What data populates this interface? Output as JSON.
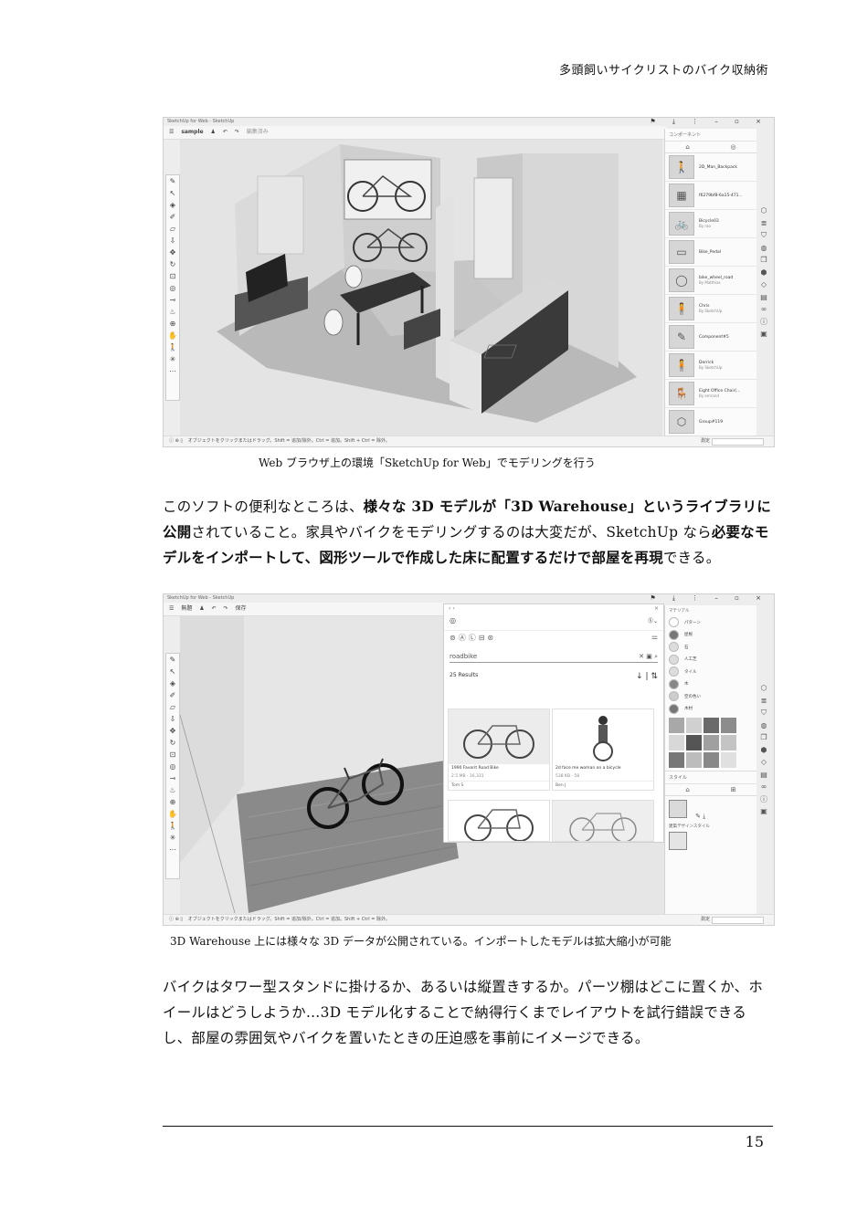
{
  "running_head": "多頭飼いサイクリストのバイク収納術",
  "figure1": {
    "window_title": "SketchUp for Web - SketchUp",
    "file_name": "sample",
    "menu_hint": "編集済み",
    "panel_title": "コンポーネント",
    "components": [
      {
        "name": "2D_Man_Backpack",
        "by": ""
      },
      {
        "name": "f6279bf8-6a15-471...",
        "by": ""
      },
      {
        "name": "Bicycle03",
        "by": "By rao"
      },
      {
        "name": "Bike_Pedal",
        "by": ""
      },
      {
        "name": "bike_wheel_road",
        "by": "By Matthias"
      },
      {
        "name": "Chris",
        "by": "By SketchUp"
      },
      {
        "name": "Component#5",
        "by": ""
      },
      {
        "name": "Derrick",
        "by": "By SketchUp"
      },
      {
        "name": "Eight Office Chair(...",
        "by": "By emrand"
      },
      {
        "name": "Group#119",
        "by": ""
      }
    ],
    "status_text": "オブジェクトをクリックまたはドラッグ。Shift = 追加/除外。Ctrl = 追加。Shift + Ctrl = 除外。",
    "measure_label": "測定",
    "caption": "Web ブラウザ上の環境「SketchUp for Web」でモデリングを行う"
  },
  "paragraph1": {
    "parts": [
      {
        "text": "このソフトの便利なところは、",
        "bold": false
      },
      {
        "text": "様々な 3D モデルが「3D Warehouse」というライブラリに公開",
        "bold": true
      },
      {
        "text": "されていること。家具やバイクをモデリングするのは大変だが、SketchUp なら",
        "bold": false
      },
      {
        "text": "必要なモデルをインポートして、図形ツールで作成した床に配置するだけで部屋を再現",
        "bold": true
      },
      {
        "text": "できる。",
        "bold": false
      }
    ]
  },
  "figure2": {
    "window_title": "SketchUp for Web - SketchUp",
    "file_name": "無題",
    "save_label": "保存",
    "search_value": "roadbike",
    "results_count": "25 Results",
    "results": [
      {
        "title": "1990 Favorit Road Bike",
        "size": "2.5 MB",
        "count": "16,331",
        "author": "Tom S"
      },
      {
        "title": "2d face me woman on a bicycle",
        "size": "538 KB",
        "count": "58",
        "author": "Ben J"
      },
      {
        "title": "",
        "size": "",
        "count": "",
        "author": ""
      },
      {
        "title": "",
        "size": "",
        "count": "",
        "author": ""
      }
    ],
    "materials_title": "マテリアル",
    "material_categories": [
      "パターン",
      "屋根",
      "石",
      "人工芝",
      "タイル",
      "木",
      "空の色い",
      "木材"
    ],
    "style_title": "スタイル",
    "style_name": "建築デザインスタイル",
    "status_text": "オブジェクトをクリックまたはドラッグ。Shift = 追加/除外。Ctrl = 追加。Shift + Ctrl = 除外。",
    "measure_label": "測定",
    "caption": "3D Warehouse 上には様々な 3D データが公開されている。インポートしたモデルは拡大縮小が可能"
  },
  "paragraph2": "バイクはタワー型スタンドに掛けるか、あるいは縦置きするか。パーツ棚はどこに置くか、ホイールはどうしようか…3D モデル化することで納得行くまでレイアウトを試行錯誤できるし、部屋の雰囲気やバイクを置いたときの圧迫感を事前にイメージできる。",
  "page_number": "15"
}
